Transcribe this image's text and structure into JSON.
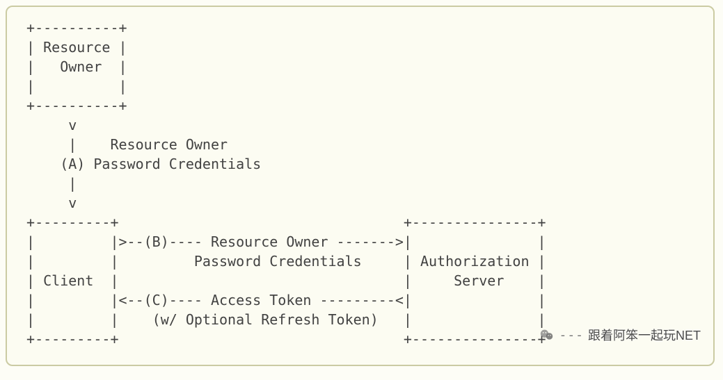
{
  "diagram": {
    "lines": [
      " +----------+",
      " | Resource |",
      " |   Owner  |",
      " |          |",
      " +----------+",
      "      v",
      "      |    Resource Owner",
      "     (A) Password Credentials",
      "      |",
      "      v",
      " +---------+                                  +---------------+",
      " |         |>--(B)---- Resource Owner ------->|               |",
      " |         |         Password Credentials     | Authorization |",
      " | Client  |                                  |     Server    |",
      " |         |<--(C)---- Access Token ---------<|               |",
      " |         |    (w/ Optional Refresh Token)   |               |",
      " +---------+                                  +---------------+"
    ]
  },
  "watermark": {
    "prefix_dashes": "---",
    "text": "跟着阿笨一起玩NET",
    "icon": "wechat-icon"
  }
}
